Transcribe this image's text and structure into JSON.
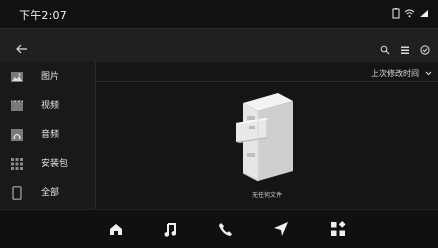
{
  "status": {
    "time": "下午2:07"
  },
  "toolbar": {
    "back_icon": "arrow-left-icon",
    "actions": [
      "search-icon",
      "list-view-icon",
      "check-circle-icon"
    ]
  },
  "sidebar": {
    "items": [
      {
        "label": "图片",
        "icon": "image-icon"
      },
      {
        "label": "视频",
        "icon": "video-icon"
      },
      {
        "label": "音频",
        "icon": "audio-icon"
      },
      {
        "label": "安装包",
        "icon": "apps-grid-icon"
      },
      {
        "label": "全部",
        "icon": "phone-device-icon"
      }
    ]
  },
  "main": {
    "sort_label": "上次修改时间",
    "empty_text": "无任何文件"
  },
  "dock": {
    "items": [
      "home-icon",
      "music-icon",
      "phone-icon",
      "navigation-icon",
      "apps-icon"
    ]
  },
  "colors": {
    "background": "#141414",
    "panel": "#202020",
    "text": "#e9e9e9"
  }
}
